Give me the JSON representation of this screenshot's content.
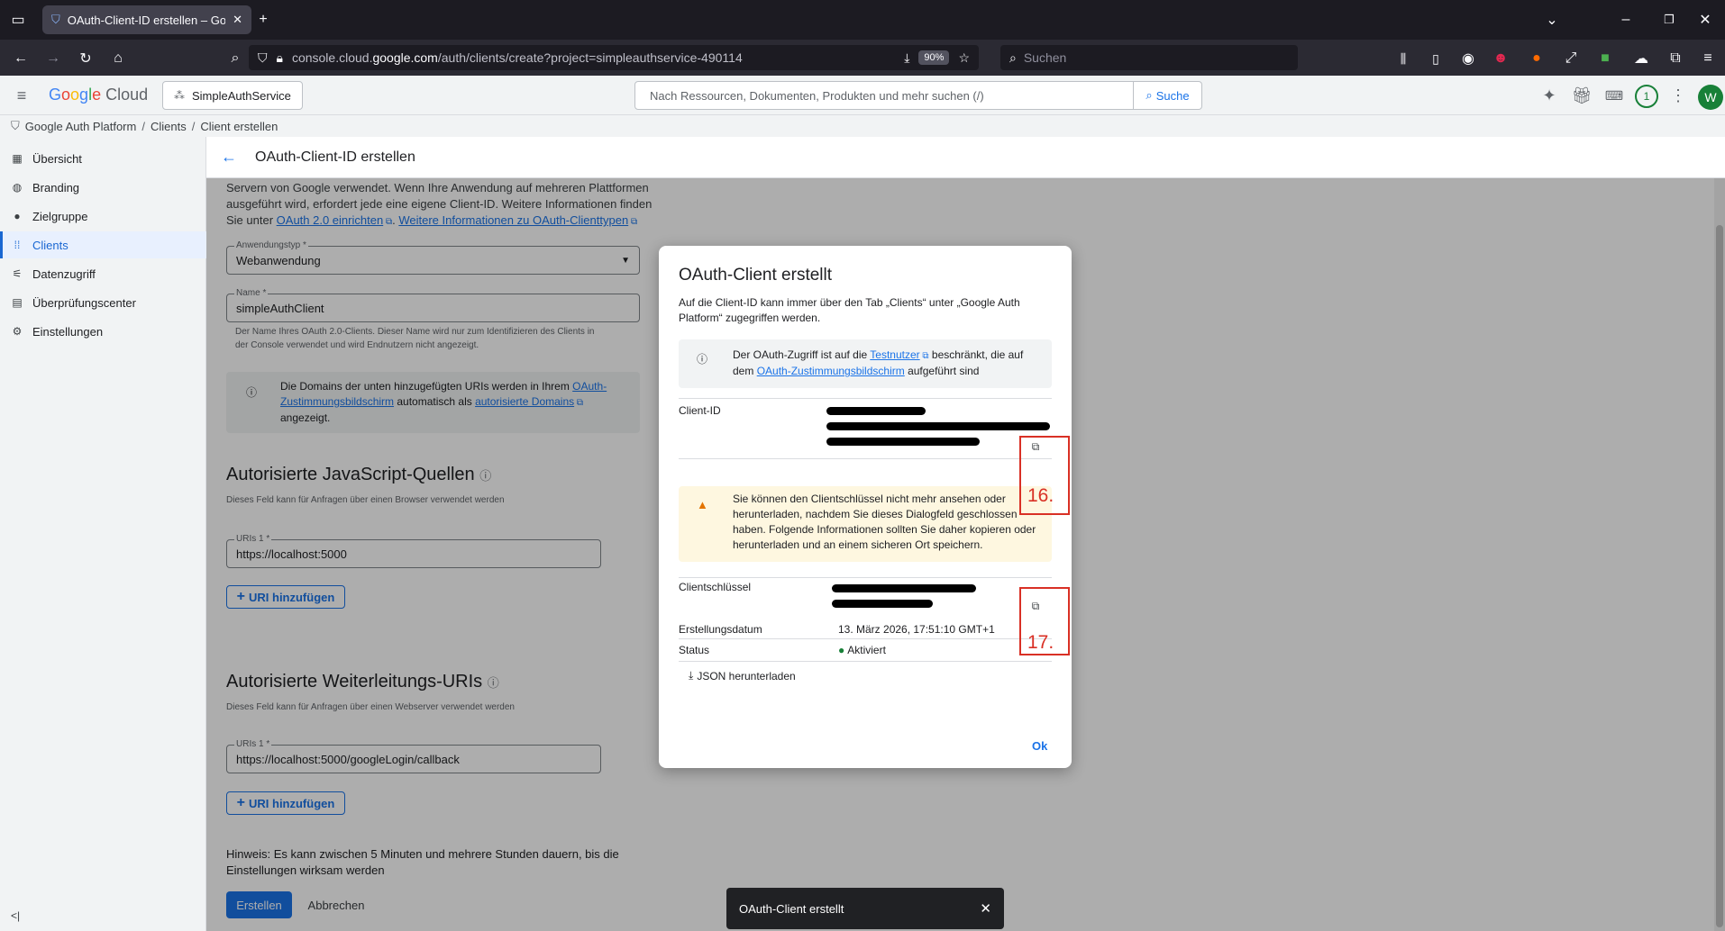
{
  "browser": {
    "tab_title": "OAuth-Client-ID erstellen – Goo",
    "url_prefix": "console.cloud.",
    "url_domain": "google.com",
    "url_path": "/auth/clients/create?project=simpleauthservice-490114",
    "zoom": "90%",
    "search_placeholder": "Suchen"
  },
  "header": {
    "logo_text": "Google Cloud",
    "project_name": "SimpleAuthService",
    "search_placeholder": "Nach Ressourcen, Dokumenten, Produkten und mehr suchen (/)",
    "search_button": "Suche",
    "notification_count": "1",
    "avatar_letter": "W"
  },
  "breadcrumb": {
    "items": [
      "Google Auth Platform",
      "Clients",
      "Client erstellen"
    ],
    "separator": "/"
  },
  "sidebar": {
    "items": [
      {
        "label": "Übersicht",
        "icon": "dashboard-icon"
      },
      {
        "label": "Branding",
        "icon": "palette-icon"
      },
      {
        "label": "Zielgruppe",
        "icon": "person-icon"
      },
      {
        "label": "Clients",
        "icon": "grid-icon"
      },
      {
        "label": "Datenzugriff",
        "icon": "data-access-icon"
      },
      {
        "label": "Überprüfungscenter",
        "icon": "review-icon"
      },
      {
        "label": "Einstellungen",
        "icon": "gear-icon"
      }
    ],
    "collapse_label": "<|"
  },
  "page": {
    "title": "OAuth-Client-ID erstellen",
    "intro_line1": "Servern von Google verwendet. Wenn Ihre Anwendung auf mehreren Plattformen",
    "intro_line2": "ausgeführt wird, erfordert jede eine eigene Client-ID. Weitere Informationen finden",
    "intro_line3_prefix": "Sie unter ",
    "intro_link1": "OAuth 2.0 einrichten",
    "intro_sep": ". ",
    "intro_link2": "Weitere Informationen zu OAuth-Clienttypen",
    "app_type_label": "Anwendungstyp *",
    "app_type_value": "Webanwendung",
    "name_label": "Name *",
    "name_value": "simpleAuthClient",
    "name_help_line1": "Der Name Ihres OAuth 2.0-Clients. Dieser Name wird nur zum Identifizieren des Clients in",
    "name_help_line2": "der Console verwendet und wird Endnutzern nicht angezeigt.",
    "domain_info_prefix": "Die Domains der unten hinzugefügten URIs werden in Ihrem ",
    "domain_info_link1": "OAuth-Zustimmungsbildschirm",
    "domain_info_middle": " automatisch als ",
    "domain_info_link2": "autorisierte Domains",
    "domain_info_suffix": "angezeigt.",
    "js_section_title": "Autorisierte JavaScript-Quellen",
    "js_section_help": "Dieses Feld kann für Anfragen über einen Browser verwendet werden",
    "js_uri_label": "URIs 1 *",
    "js_uri_value": "https://localhost:5000",
    "add_uri_label": "URI hinzufügen",
    "redirect_section_title": "Autorisierte Weiterleitungs-URIs",
    "redirect_section_help": "Dieses Feld kann für Anfragen über einen Webserver verwendet werden",
    "redirect_uri_label": "URIs 1 *",
    "redirect_uri_value": "https://localhost:5000/googleLogin/callback",
    "note_line1": "Hinweis: Es kann zwischen 5 Minuten und mehrere Stunden dauern, bis die",
    "note_line2": "Einstellungen wirksam werden",
    "create_button": "Erstellen",
    "cancel_button": "Abbrechen"
  },
  "dialog": {
    "title": "OAuth-Client erstellt",
    "description": "Auf die Client-ID kann immer über den Tab „Clients“ unter „Google Auth Platform“ zugegriffen werden.",
    "info_prefix": "Der OAuth-Zugriff ist auf die ",
    "info_link1": "Testnutzer",
    "info_middle": " beschränkt, die auf dem ",
    "info_link2": "OAuth-Zustimmungsbildschirm",
    "info_suffix": " aufgeführt sind",
    "client_id_label": "Client-ID",
    "warning_text": "Sie können den Clientschlüssel nicht mehr ansehen oder herunterladen, nachdem Sie dieses Dialogfeld geschlossen haben. Folgende Informationen sollten Sie daher kopieren oder herunterladen und an einem sicheren Ort speichern.",
    "secret_label": "Clientschlüssel",
    "created_label": "Erstellungsdatum",
    "created_value": "13. März 2026, 17:51:10 GMT+1",
    "status_label": "Status",
    "status_value": "Aktiviert",
    "download_json": "JSON herunterladen",
    "ok_button": "Ok"
  },
  "annotations": {
    "marker_16": "16.",
    "marker_17": "17.",
    "color": "#d93025"
  },
  "snackbar": {
    "message": "OAuth-Client erstellt"
  },
  "colors": {
    "accent": "#1a73e8",
    "active_bg": "#e8f0fe",
    "success": "#188038",
    "warning_bg": "#fef7e0",
    "warning_icon": "#e37400"
  }
}
